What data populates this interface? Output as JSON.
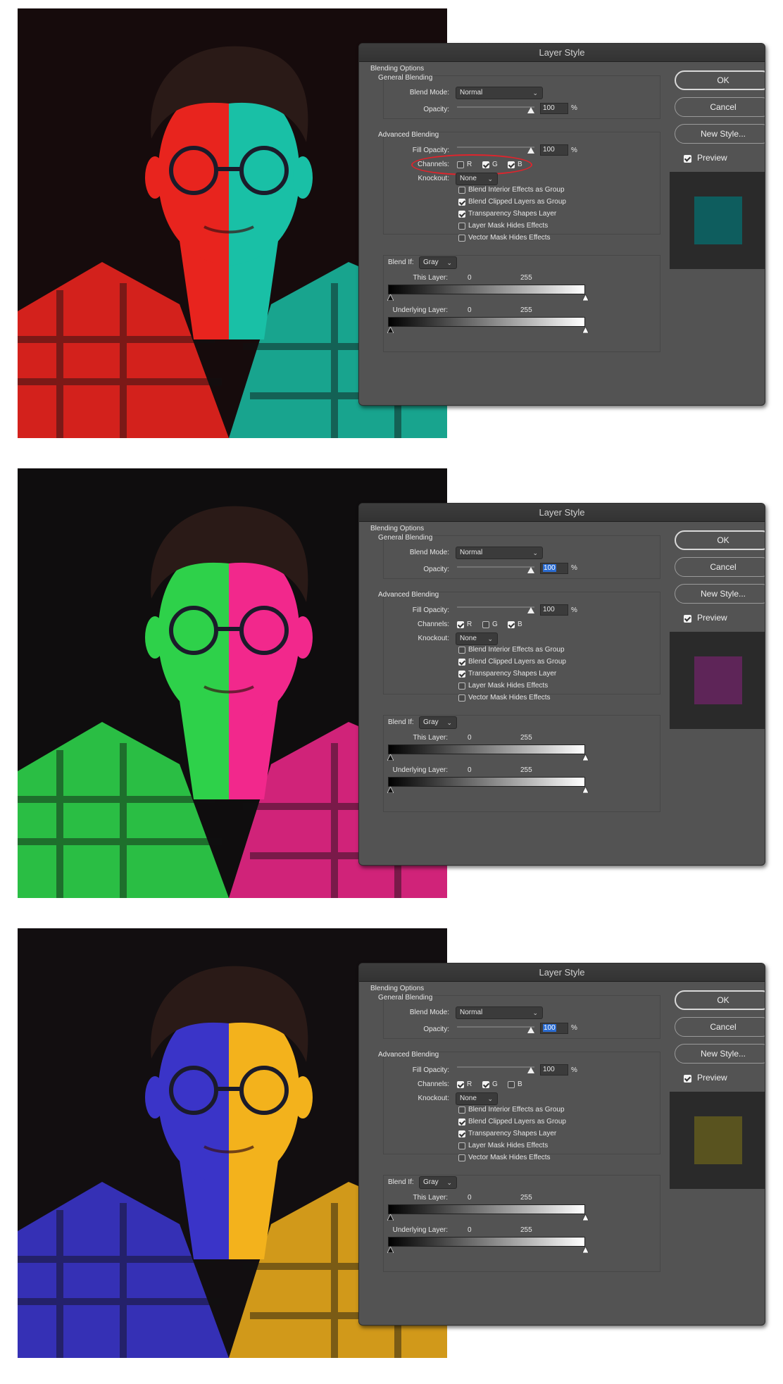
{
  "panels": [
    {
      "dialog_title": "Layer Style",
      "blending_options": "Blending Options",
      "general_blending": "General Blending",
      "blend_mode_label": "Blend Mode:",
      "blend_mode_value": "Normal",
      "opacity_label": "Opacity:",
      "opacity_value": "100",
      "opacity_selected": false,
      "percent": "%",
      "advanced_blending": "Advanced Blending",
      "fill_opacity_label": "Fill Opacity:",
      "fill_opacity_value": "100",
      "channels_label": "Channels:",
      "channels": [
        {
          "label": "R",
          "checked": false
        },
        {
          "label": "G",
          "checked": true
        },
        {
          "label": "B",
          "checked": true
        }
      ],
      "channels_circled": true,
      "knockout_label": "Knockout:",
      "knockout_value": "None",
      "options": [
        {
          "label": "Blend Interior Effects as Group",
          "checked": false
        },
        {
          "label": "Blend Clipped Layers as Group",
          "checked": true
        },
        {
          "label": "Transparency Shapes Layer",
          "checked": true
        },
        {
          "label": "Layer Mask Hides Effects",
          "checked": false
        },
        {
          "label": "Vector Mask Hides Effects",
          "checked": false
        }
      ],
      "blend_if_label": "Blend If:",
      "blend_if_value": "Gray",
      "this_layer_label": "This Layer:",
      "underlying_layer_label": "Underlying Layer:",
      "range_min": "0",
      "range_max": "255",
      "ok_label": "OK",
      "cancel_label": "Cancel",
      "new_style_label": "New Style...",
      "preview_label": "Preview",
      "preview_checked": true,
      "swatch_color": "#0e5d5e",
      "photo_palette": {
        "left": "#e8241e",
        "right": "#19c0a6",
        "bg": "#160b0c"
      }
    },
    {
      "dialog_title": "Layer Style",
      "blending_options": "Blending Options",
      "general_blending": "General Blending",
      "blend_mode_label": "Blend Mode:",
      "blend_mode_value": "Normal",
      "opacity_label": "Opacity:",
      "opacity_value": "100",
      "opacity_selected": true,
      "percent": "%",
      "advanced_blending": "Advanced Blending",
      "fill_opacity_label": "Fill Opacity:",
      "fill_opacity_value": "100",
      "channels_label": "Channels:",
      "channels": [
        {
          "label": "R",
          "checked": true
        },
        {
          "label": "G",
          "checked": false
        },
        {
          "label": "B",
          "checked": true
        }
      ],
      "channels_circled": false,
      "knockout_label": "Knockout:",
      "knockout_value": "None",
      "options": [
        {
          "label": "Blend Interior Effects as Group",
          "checked": false
        },
        {
          "label": "Blend Clipped Layers as Group",
          "checked": true
        },
        {
          "label": "Transparency Shapes Layer",
          "checked": true
        },
        {
          "label": "Layer Mask Hides Effects",
          "checked": false
        },
        {
          "label": "Vector Mask Hides Effects",
          "checked": false
        }
      ],
      "blend_if_label": "Blend If:",
      "blend_if_value": "Gray",
      "this_layer_label": "This Layer:",
      "underlying_layer_label": "Underlying Layer:",
      "range_min": "0",
      "range_max": "255",
      "ok_label": "OK",
      "cancel_label": "Cancel",
      "new_style_label": "New Style...",
      "preview_label": "Preview",
      "preview_checked": true,
      "swatch_color": "#5e2558",
      "photo_palette": {
        "left": "#2ed14a",
        "right": "#f2288c",
        "bg": "#0f0d0e"
      }
    },
    {
      "dialog_title": "Layer Style",
      "blending_options": "Blending Options",
      "general_blending": "General Blending",
      "blend_mode_label": "Blend Mode:",
      "blend_mode_value": "Normal",
      "opacity_label": "Opacity:",
      "opacity_value": "100",
      "opacity_selected": true,
      "percent": "%",
      "advanced_blending": "Advanced Blending",
      "fill_opacity_label": "Fill Opacity:",
      "fill_opacity_value": "100",
      "channels_label": "Channels:",
      "channels": [
        {
          "label": "R",
          "checked": true
        },
        {
          "label": "G",
          "checked": true
        },
        {
          "label": "B",
          "checked": false
        }
      ],
      "channels_circled": false,
      "knockout_label": "Knockout:",
      "knockout_value": "None",
      "options": [
        {
          "label": "Blend Interior Effects as Group",
          "checked": false
        },
        {
          "label": "Blend Clipped Layers as Group",
          "checked": true
        },
        {
          "label": "Transparency Shapes Layer",
          "checked": true
        },
        {
          "label": "Layer Mask Hides Effects",
          "checked": false
        },
        {
          "label": "Vector Mask Hides Effects",
          "checked": false
        }
      ],
      "blend_if_label": "Blend If:",
      "blend_if_value": "Gray",
      "this_layer_label": "This Layer:",
      "underlying_layer_label": "Underlying Layer:",
      "range_min": "0",
      "range_max": "255",
      "ok_label": "OK",
      "cancel_label": "Cancel",
      "new_style_label": "New Style...",
      "preview_label": "Preview",
      "preview_checked": true,
      "swatch_color": "#59531f",
      "photo_palette": {
        "left": "#3a34c8",
        "right": "#f3b21c",
        "bg": "#120e10"
      }
    }
  ]
}
